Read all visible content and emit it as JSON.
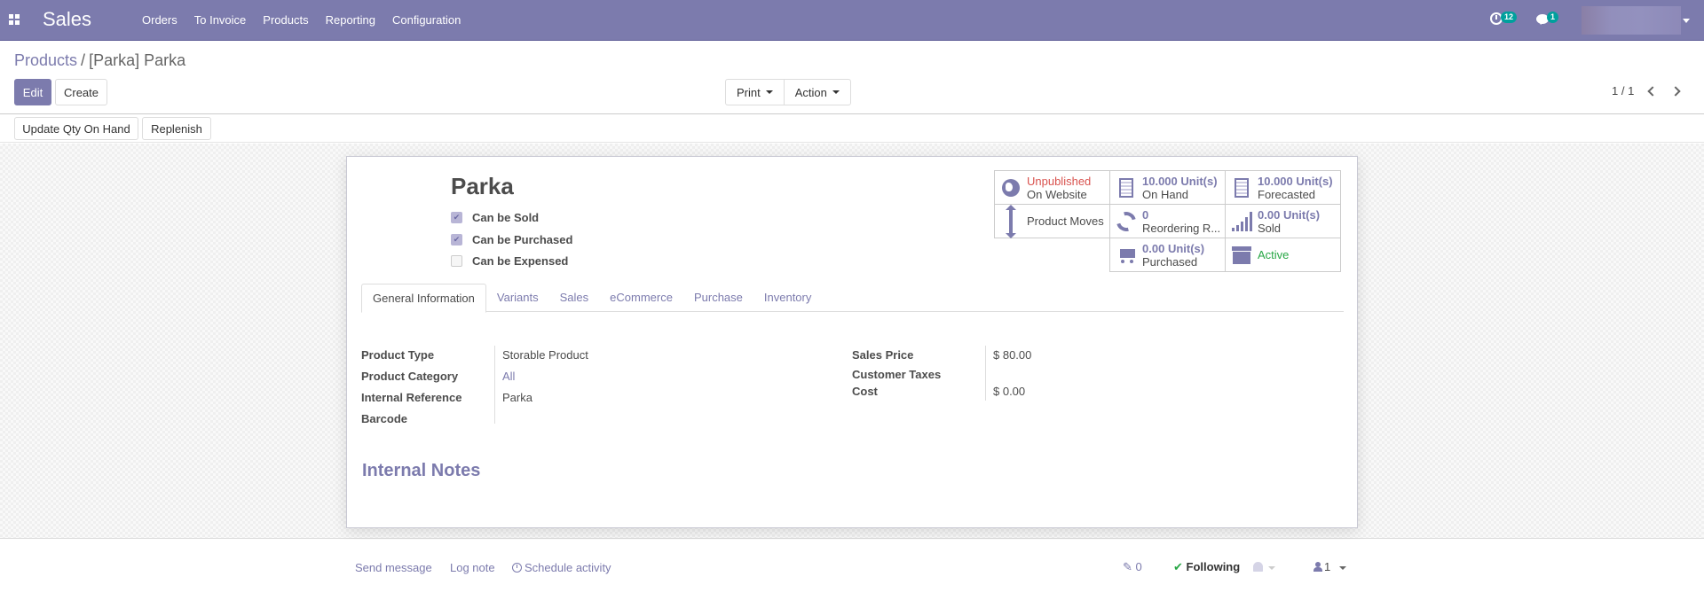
{
  "navbar": {
    "app_name": "Sales",
    "menu": [
      "Orders",
      "To Invoice",
      "Products",
      "Reporting",
      "Configuration"
    ],
    "activity_count": "12",
    "message_count": "1",
    "accent_color": "#7c7bad",
    "badge_color": "#00a09d"
  },
  "breadcrumb": {
    "parent": "Products",
    "separator": "/",
    "current": "[Parka] Parka"
  },
  "buttons": {
    "edit": "Edit",
    "create": "Create",
    "print": "Print",
    "action": "Action"
  },
  "pager": {
    "value": "1 / 1"
  },
  "statusbar": {
    "update_qty": "Update Qty On Hand",
    "replenish": "Replenish"
  },
  "product": {
    "name": "Parka",
    "checkboxes": [
      {
        "label": "Can be Sold",
        "checked": true
      },
      {
        "label": "Can be Purchased",
        "checked": true
      },
      {
        "label": "Can be Expensed",
        "checked": false
      }
    ]
  },
  "smart_buttons": {
    "website": {
      "status": "Unpublished",
      "label": "On Website",
      "icon": "globe-icon"
    },
    "on_hand": {
      "value": "10.000",
      "unit": "Unit(s)",
      "label": "On Hand",
      "icon": "building-icon"
    },
    "forecasted": {
      "value": "10.000",
      "unit": "Unit(s)",
      "label": "Forecasted",
      "icon": "building-icon"
    },
    "moves": {
      "label": "Product Moves",
      "icon": "arrows-v-icon"
    },
    "reordering": {
      "value": "0",
      "label": "Reordering R...",
      "icon": "refresh-icon"
    },
    "sold": {
      "value": "0.00",
      "unit": "Unit(s)",
      "label": "Sold",
      "icon": "signal-icon"
    },
    "purchased": {
      "value": "0.00",
      "unit": "Unit(s)",
      "label": "Purchased",
      "icon": "cart-icon"
    },
    "active": {
      "label": "Active",
      "icon": "archive-icon"
    }
  },
  "tabs": [
    "General Information",
    "Variants",
    "Sales",
    "eCommerce",
    "Purchase",
    "Inventory"
  ],
  "active_tab": "General Information",
  "general_info": {
    "left": [
      {
        "label": "Product Type",
        "value": "Storable Product"
      },
      {
        "label": "Product Category",
        "value": "All"
      },
      {
        "label": "Internal Reference",
        "value": "Parka"
      },
      {
        "label": "Barcode",
        "value": ""
      }
    ],
    "right": [
      {
        "label": "Sales Price",
        "value": "$ 80.00"
      },
      {
        "label": "Customer Taxes",
        "value": ""
      },
      {
        "label": "Cost",
        "value": "$ 0.00"
      }
    ]
  },
  "internal_notes_title": "Internal Notes",
  "chatter": {
    "send_message": "Send message",
    "log_note": "Log note",
    "schedule_activity": "Schedule activity",
    "attachments": "0",
    "following": "Following",
    "followers": "1"
  }
}
